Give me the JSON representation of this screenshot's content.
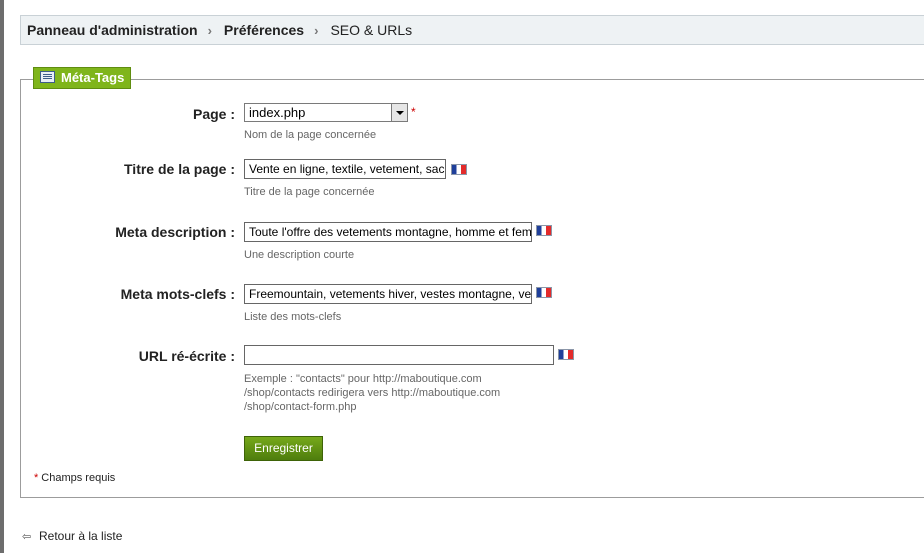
{
  "breadcrumb": {
    "item1": "Panneau d'administration",
    "item2": "Préférences",
    "current": "SEO & URLs",
    "separator": "›"
  },
  "section": {
    "legend": "Méta-Tags",
    "icon": "keyboard-icon"
  },
  "form": {
    "page": {
      "label": "Page :",
      "value": "index.php",
      "required": "*",
      "hint": "Nom de la page concernée"
    },
    "title": {
      "label": "Titre de la page :",
      "value": "Vente en ligne, textile, vetement, sac",
      "hint": "Titre de la page concernée"
    },
    "description": {
      "label": "Meta description :",
      "value": "Toute l'offre des vetements montagne, homme et femme",
      "hint": "Une description courte"
    },
    "keywords": {
      "label": "Meta mots-clefs :",
      "value": "Freemountain, vetements hiver, vestes montagne, vestes",
      "hint": "Liste des mots-clefs"
    },
    "url": {
      "label": "URL ré-écrite :",
      "value": "",
      "hint_line1": "Exemple : \"contacts\" pour http://maboutique.com",
      "hint_line2": "/shop/contacts redirigera vers http://maboutique.com",
      "hint_line3": "/shop/contact-form.php"
    },
    "save_label": "Enregistrer",
    "required_star": "*",
    "required_note": "Champs requis"
  },
  "back_link": {
    "label": "Retour à la liste",
    "icon": "back-arrow-icon"
  },
  "colors": {
    "accent": "#7fb51b",
    "breadcrumb_bg": "#eef2f4",
    "required": "#cc0000"
  }
}
